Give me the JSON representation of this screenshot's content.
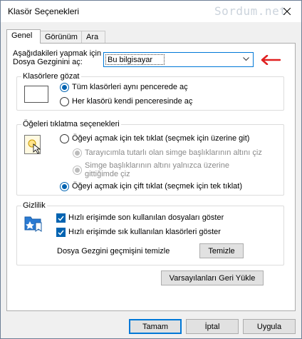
{
  "window": {
    "title": "Klasör Seçenekleri"
  },
  "watermark": "Sordum.net",
  "tabs": [
    {
      "label": "Genel",
      "active": true
    },
    {
      "label": "Görünüm",
      "active": false
    },
    {
      "label": "Ara",
      "active": false
    }
  ],
  "open_explorer": {
    "label_line1": "Aşağıdakileri yapmak için",
    "label_line2": "Dosya Gezginini aç:",
    "selected": "Bu bilgisayar"
  },
  "browse_group": {
    "title": "Klasörlere gözat",
    "options": [
      {
        "label": "Tüm klasörleri aynı pencerede aç",
        "checked": true
      },
      {
        "label": "Her klasörü kendi penceresinde aç",
        "checked": false
      }
    ]
  },
  "click_group": {
    "title": "Öğeleri tıklatma seçenekleri",
    "single_click": "Öğeyi açmak için tek tıklat (seçmek için üzerine git)",
    "sub_option1": "Tarayıcımla tutarlı olan simge başlıklarının altını çiz",
    "sub_option2_line1": "Simge başlıklarının altını yalnızca üzerine",
    "sub_option2_line2": "gittiğimde çiz",
    "double_click": "Öğeyi açmak için çift tıklat (seçmek için tek tıklat)"
  },
  "privacy_group": {
    "title": "Gizlilik",
    "check1": "Hızlı erişimde son kullanılan dosyaları göster",
    "check2": "Hızlı erişimde sık kullanılan klasörleri göster",
    "clear_label": "Dosya Gezgini geçmişini temizle",
    "clear_button": "Temizle"
  },
  "restore_button": "Varsayılanları Geri Yükle",
  "footer": {
    "ok": "Tamam",
    "cancel": "İptal",
    "apply": "Uygula"
  },
  "colors": {
    "accent": "#0063b1",
    "arrow": "#e02020"
  }
}
